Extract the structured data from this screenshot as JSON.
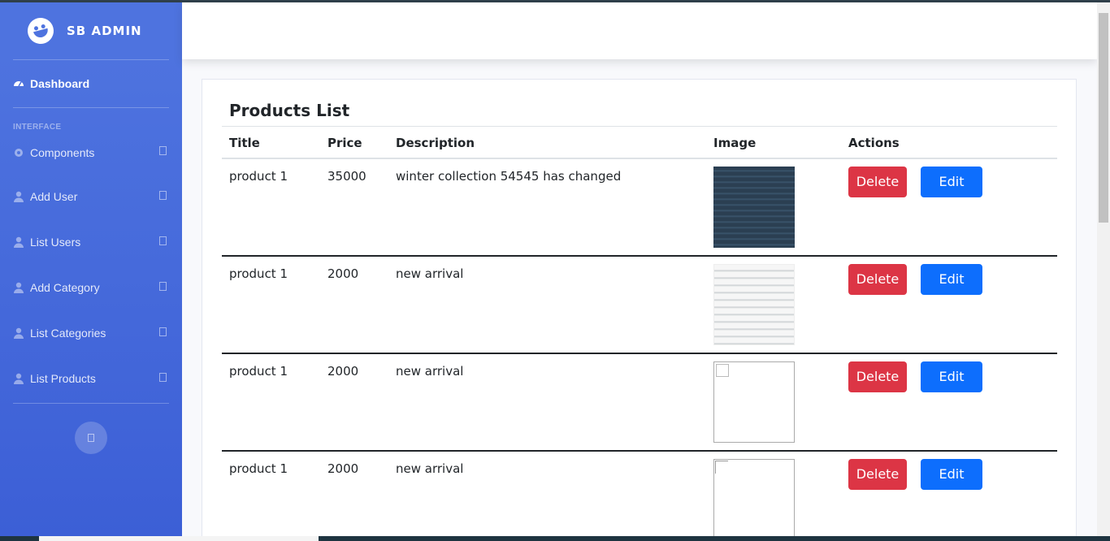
{
  "brand": {
    "name": "SB ADMIN",
    "icon": "laugh-wink-icon"
  },
  "nav": {
    "dashboard": {
      "label": "Dashboard",
      "icon": "tachometer-icon"
    },
    "section_heading": "INTERFACE",
    "items": [
      {
        "label": "Components",
        "icon": "cog-icon"
      },
      {
        "label": "Add User",
        "icon": "user-icon"
      },
      {
        "label": "List Users",
        "icon": "user-icon"
      },
      {
        "label": "Add Category",
        "icon": "user-icon"
      },
      {
        "label": "List Categories",
        "icon": "user-icon"
      },
      {
        "label": "List Products",
        "icon": "user-icon"
      }
    ]
  },
  "card": {
    "title": "Products List"
  },
  "table": {
    "headers": [
      "Title",
      "Price",
      "Description",
      "Image",
      "Actions"
    ],
    "rows": [
      {
        "title": "product 1",
        "price": "35000",
        "description": "winter collection 54545 has changed",
        "image": "code-screenshot"
      },
      {
        "title": "product 1",
        "price": "2000",
        "description": "new arrival",
        "image": "ui-screenshot"
      },
      {
        "title": "product 1",
        "price": "2000",
        "description": "new arrival",
        "image": "broken-image"
      },
      {
        "title": "product 1",
        "price": "2000",
        "description": "new arrival",
        "image": "broken-image"
      }
    ],
    "delete_label": "Delete",
    "edit_label": "Edit"
  },
  "colors": {
    "sidebar": "#4e73df",
    "danger": "#dc3545",
    "primary": "#0d6efd"
  }
}
